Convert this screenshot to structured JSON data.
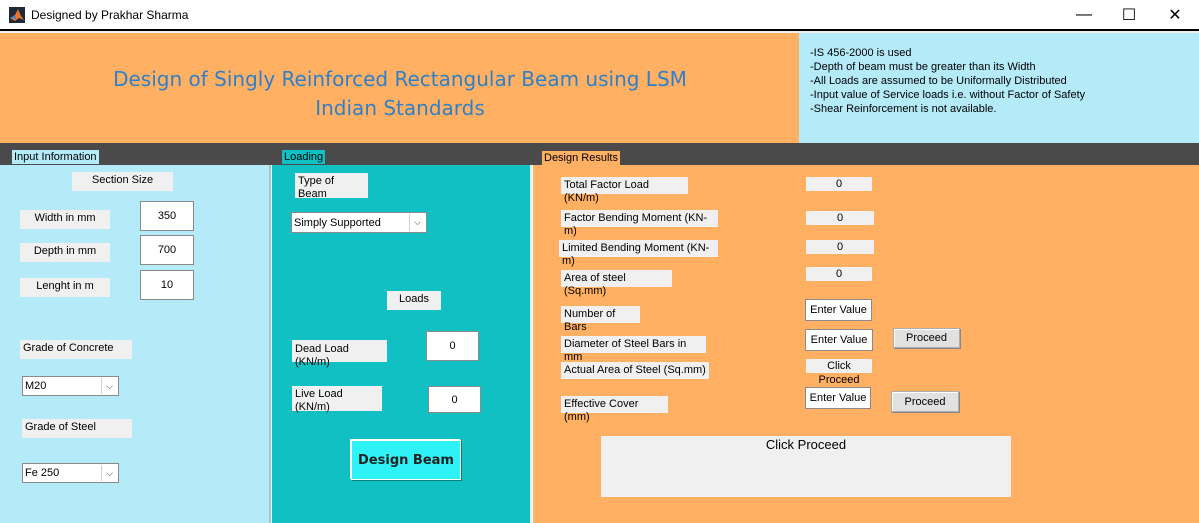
{
  "window": {
    "title": "Designed by Prakhar Sharma",
    "minimize": "—",
    "maximize": "☐",
    "close": "✕"
  },
  "header": {
    "heading_line1": "Design of Singly Reinforced Rectangular Beam using LSM",
    "heading_line2": "Indian Standards",
    "notes": [
      "-IS 456-2000 is used",
      "-Depth of beam must be greater than its Width",
      "-All Loads are assumed to be Uniformally  Distributed",
      "-Input value of Service loads i.e. without Factor of Safety",
      "-Shear Reinforcement is not available."
    ]
  },
  "input_panel": {
    "title": "Input Information",
    "section_size": "Section Size",
    "width_label": "Width in mm",
    "width_value": "350",
    "depth_label": "Depth in mm",
    "depth_value": "700",
    "length_label": "Lenght in m",
    "length_value": "10",
    "concrete_label": "Grade of Concrete",
    "concrete_value": "M20",
    "steel_label": "Grade of Steel",
    "steel_value": "Fe 250"
  },
  "loading_panel": {
    "title": "Loading",
    "type_label": "Type of Beam",
    "type_value": "Simply Supported",
    "loads_label": "Loads",
    "dead_label": "Dead Load (KN/m)",
    "dead_value": "0",
    "live_label": "Live Load (KN/m)",
    "live_value": "0",
    "design_button": "Design Beam"
  },
  "results_panel": {
    "title": "Design Results",
    "total_load_label": "Total Factor Load (KN/m)",
    "total_load_value": "0",
    "factor_moment_label": "Factor Bending Moment (KN-m)",
    "factor_moment_value": "0",
    "limited_moment_label": "Limited Bending Moment (KN-m)",
    "limited_moment_value": "0",
    "area_steel_label": "Area of steel (Sq.mm)",
    "area_steel_value": "0",
    "bars_label": "Number of Bars",
    "bars_value": "Enter Value",
    "diameter_label": "Diameter of Steel Bars in mm",
    "diameter_value": "Enter Value",
    "proceed1": "Proceed",
    "actual_area_label": "Actual Area of Steel (Sq.mm)",
    "actual_area_value": "Click Proceed",
    "cover_label": "Effective Cover (mm)",
    "cover_value": "Enter Value",
    "proceed2": "Proceed",
    "result_box": "Click Proceed"
  },
  "colors": {
    "header_orange": "#ffb062",
    "info_blue": "#b5eaf9",
    "loading_teal": "#11c0c2",
    "heading_blue": "#2f80c8",
    "design_button": "#2ef2f5"
  }
}
